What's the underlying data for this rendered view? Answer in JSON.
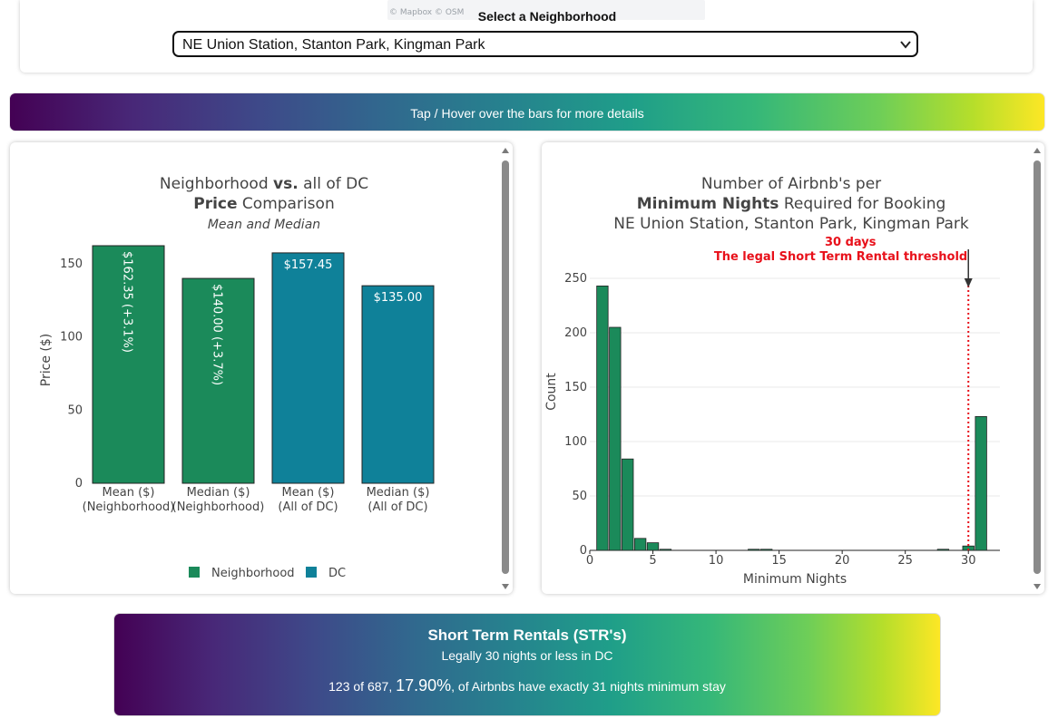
{
  "map": {
    "attribution": "© Mapbox © OSM"
  },
  "selector": {
    "label": "Select a Neighborhood",
    "value": "NE Union Station, Stanton Park, Kingman Park"
  },
  "banner": {
    "text": "Tap / Hover over the bars for more details"
  },
  "colors": {
    "neighborhood": "#1b8a5a",
    "dc": "#0f8199",
    "threshold": "#e8101a"
  },
  "price_chart": {
    "title_part1": "Neighborhood ",
    "title_bold1": "vs.",
    "title_part2": " all of DC",
    "title2_bold": "Price",
    "title2_rest": " Comparison",
    "subtitle": "Mean and Median",
    "ylabel": "Price ($)",
    "legend": {
      "neighborhood": "Neighborhood",
      "dc": "DC"
    },
    "chart_data": {
      "type": "bar",
      "title": "Neighborhood vs. all of DC Price Comparison",
      "subtitle": "Mean and Median",
      "xlabel": "",
      "ylabel": "Price ($)",
      "ylim": [
        0,
        162.35
      ],
      "yticks": [
        0,
        50,
        100,
        150
      ],
      "categories": [
        [
          "Mean ($)",
          "(Neighborhood)"
        ],
        [
          "Median ($)",
          "(Neighborhood)"
        ],
        [
          "Mean ($)",
          "(All of DC)"
        ],
        [
          "Median ($)",
          "(All of DC)"
        ]
      ],
      "values": [
        162.35,
        140.0,
        157.45,
        135.0
      ],
      "labels": [
        "$162.35 (+3.1%)",
        "$140.00 (+3.7%)",
        "$157.45",
        "$135.00"
      ],
      "groups": [
        "Neighborhood",
        "Neighborhood",
        "DC",
        "DC"
      ],
      "legend": "bottom-center",
      "grid": false
    }
  },
  "nights_chart": {
    "title1": "Number of Airbnb's per",
    "title2_bold": "Minimum Nights",
    "title2_rest": " Required for Booking",
    "title3": "NE Union Station, Stanton Park, Kingman Park",
    "annotation1": "30 days",
    "annotation2": "The legal Short Term Rental threshold",
    "xlabel": "Minimum Nights",
    "ylabel": "Count",
    "chart_data": {
      "type": "bar",
      "title": "Number of Airbnb's per Minimum Nights Required for Booking",
      "subtitle": "NE Union Station, Stanton Park, Kingman Park",
      "xlabel": "Minimum Nights",
      "ylabel": "Count",
      "xlim": [
        0,
        32.5
      ],
      "ylim": [
        0,
        250
      ],
      "xticks": [
        0,
        5,
        10,
        15,
        20,
        25,
        30
      ],
      "yticks": [
        0,
        50,
        100,
        150,
        200,
        250
      ],
      "x": [
        1,
        2,
        3,
        4,
        5,
        6,
        13,
        14,
        28,
        30,
        31
      ],
      "values": [
        243,
        205,
        84,
        11,
        7,
        1,
        1,
        1,
        1,
        4,
        123
      ],
      "threshold": 30,
      "grid": true
    }
  },
  "str_summary": {
    "title": "Short Term Rentals (STR's)",
    "subtitle": "Legally 30 nights or less in DC",
    "stat_prefix": "123 of 687, ",
    "stat_percent": "17.90%",
    "stat_suffix": ", of Airbnbs have exactly 31 nights minimum stay"
  }
}
